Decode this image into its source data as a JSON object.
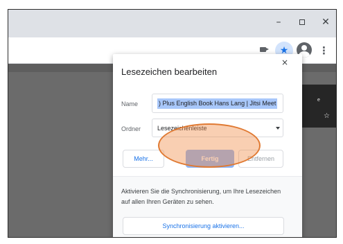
{
  "window": {
    "minimize_glyph": "–",
    "maximize_glyph": "",
    "close_glyph": "✕"
  },
  "toolbar": {
    "star_glyph": "★",
    "menu_glyph": "⋮",
    "star_active_color": "#1a73e8"
  },
  "page": {
    "side_card_text": "e",
    "side_card_star": "☆"
  },
  "dialog": {
    "title": "Lesezeichen bearbeiten",
    "close_glyph": "×",
    "name_label": "Name",
    "name_value": ") Plus English Book Hans Lang | Jitsi Meet",
    "folder_label": "Ordner",
    "folder_value": "Lesezeichenleiste",
    "more_button": "Mehr...",
    "done_button": "Fertig",
    "remove_button": "Entfernen",
    "sync_text": "Aktivieren Sie die Synchronisierung, um Ihre Lesezeichen auf allen Ihren Geräten zu sehen.",
    "sync_button": "Synchronisierung aktivieren..."
  },
  "colors": {
    "accent": "#1a73e8",
    "primary_button": "#8ab4f8",
    "highlight": "#f18c48"
  }
}
